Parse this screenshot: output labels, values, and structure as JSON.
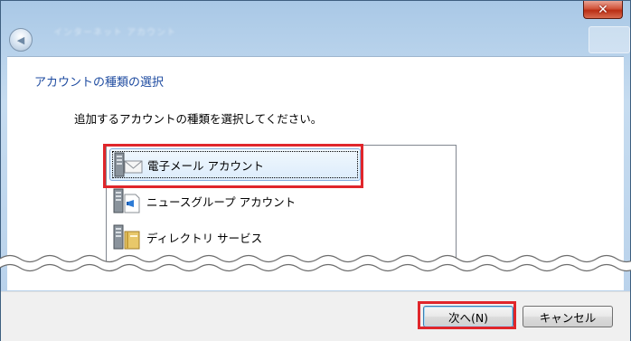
{
  "window": {
    "title": "インターネット アカウント",
    "close_label": "✕",
    "back_label": "◀"
  },
  "page": {
    "heading": "アカウントの種類の選択",
    "instruction": "追加するアカウントの種類を選択してください。"
  },
  "account_types": [
    {
      "label": "電子メール アカウント",
      "icon": "email-server-icon",
      "selected": true
    },
    {
      "label": "ニュースグループ アカウント",
      "icon": "newsgroup-server-icon",
      "selected": false
    },
    {
      "label": "ディレクトリ サービス",
      "icon": "directory-server-icon",
      "selected": false
    }
  ],
  "buttons": {
    "next": "次へ(N)",
    "cancel": "キャンセル"
  },
  "colors": {
    "heading": "#1e4ba0",
    "highlight": "#e0262b",
    "selection": "#dcecfc"
  }
}
